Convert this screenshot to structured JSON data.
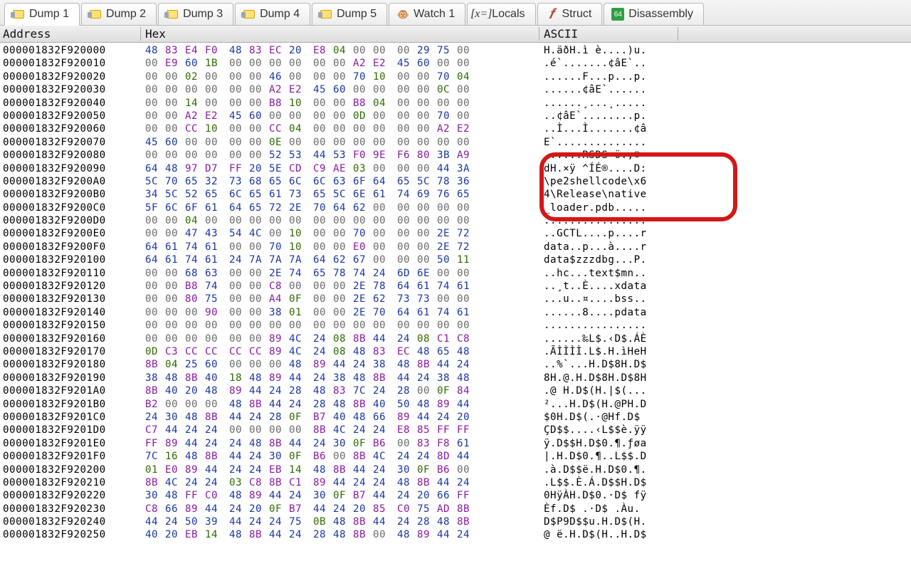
{
  "tabs": [
    {
      "label": "Dump 1",
      "icon": "dump-icon"
    },
    {
      "label": "Dump 2",
      "icon": "dump-icon"
    },
    {
      "label": "Dump 3",
      "icon": "dump-icon"
    },
    {
      "label": "Dump 4",
      "icon": "dump-icon"
    },
    {
      "label": "Dump 5",
      "icon": "dump-icon"
    },
    {
      "label": "Watch 1",
      "icon": "watch-icon"
    },
    {
      "label": "Locals",
      "icon": "locals-icon"
    },
    {
      "label": "Struct",
      "icon": "struct-icon"
    },
    {
      "label": "Disassembly",
      "icon": "disassembly-icon"
    }
  ],
  "active_tab_index": 0,
  "headers": {
    "address": "Address",
    "hex": "Hex",
    "ascii": "ASCII"
  },
  "highlight": {
    "row_start": 9,
    "row_end": 12
  },
  "rows": [
    {
      "addr": "000001832F920000",
      "hex": [
        "48",
        "83",
        "E4",
        "F0",
        "48",
        "83",
        "EC",
        "20",
        "E8",
        "04",
        "00",
        "00",
        "00",
        "29",
        "75",
        "00"
      ],
      "ascii": "H.äðH.ì è....)u."
    },
    {
      "addr": "000001832F920010",
      "hex": [
        "00",
        "E9",
        "60",
        "1B",
        "00",
        "00",
        "00",
        "00",
        "00",
        "00",
        "A2",
        "E2",
        "45",
        "60",
        "00",
        "00"
      ],
      "ascii": ".é`.......¢âE`.."
    },
    {
      "addr": "000001832F920020",
      "hex": [
        "00",
        "00",
        "02",
        "00",
        "00",
        "00",
        "46",
        "00",
        "00",
        "00",
        "70",
        "10",
        "00",
        "00",
        "70",
        "04"
      ],
      "ascii": "......F...p...p."
    },
    {
      "addr": "000001832F920030",
      "hex": [
        "00",
        "00",
        "00",
        "00",
        "00",
        "00",
        "A2",
        "E2",
        "45",
        "60",
        "00",
        "00",
        "00",
        "00",
        "0C",
        "00"
      ],
      "ascii": "......¢âE`......"
    },
    {
      "addr": "000001832F920040",
      "hex": [
        "00",
        "00",
        "14",
        "00",
        "00",
        "00",
        "B8",
        "10",
        "00",
        "00",
        "B8",
        "04",
        "00",
        "00",
        "00",
        "00"
      ],
      "ascii": "......¸...¸....."
    },
    {
      "addr": "000001832F920050",
      "hex": [
        "00",
        "00",
        "A2",
        "E2",
        "45",
        "60",
        "00",
        "00",
        "00",
        "00",
        "0D",
        "00",
        "00",
        "00",
        "70",
        "00"
      ],
      "ascii": "..¢âE`........p."
    },
    {
      "addr": "000001832F920060",
      "hex": [
        "00",
        "00",
        "CC",
        "10",
        "00",
        "00",
        "CC",
        "04",
        "00",
        "00",
        "00",
        "00",
        "00",
        "00",
        "A2",
        "E2"
      ],
      "ascii": "..Ì...Ì.......¢â"
    },
    {
      "addr": "000001832F920070",
      "hex": [
        "45",
        "60",
        "00",
        "00",
        "00",
        "00",
        "0E",
        "00",
        "00",
        "00",
        "00",
        "00",
        "00",
        "00",
        "00",
        "00"
      ],
      "ascii": "E`.............."
    },
    {
      "addr": "000001832F920080",
      "hex": [
        "00",
        "00",
        "00",
        "00",
        "00",
        "00",
        "52",
        "53",
        "44",
        "53",
        "F0",
        "9E",
        "F6",
        "80",
        "3B",
        "A9"
      ],
      "ascii": "......RSDS·ö.;©"
    },
    {
      "addr": "000001832F920090",
      "hex": [
        "64",
        "48",
        "97",
        "D7",
        "FF",
        "20",
        "5E",
        "CD",
        "C9",
        "AE",
        "03",
        "00",
        "00",
        "00",
        "44",
        "3A"
      ],
      "ascii": "dH.×ÿ ^ÍÉ®....D:"
    },
    {
      "addr": "000001832F9200A0",
      "hex": [
        "5C",
        "70",
        "65",
        "32",
        "73",
        "68",
        "65",
        "6C",
        "6C",
        "63",
        "6F",
        "64",
        "65",
        "5C",
        "78",
        "36"
      ],
      "ascii": "\\pe2shellcode\\x6"
    },
    {
      "addr": "000001832F9200B0",
      "hex": [
        "34",
        "5C",
        "52",
        "65",
        "6C",
        "65",
        "61",
        "73",
        "65",
        "5C",
        "6E",
        "61",
        "74",
        "69",
        "76",
        "65"
      ],
      "ascii": "4\\Release\\native"
    },
    {
      "addr": "000001832F9200C0",
      "hex": [
        "5F",
        "6C",
        "6F",
        "61",
        "64",
        "65",
        "72",
        "2E",
        "70",
        "64",
        "62",
        "00",
        "00",
        "00",
        "00",
        "00"
      ],
      "ascii": "_loader.pdb....."
    },
    {
      "addr": "000001832F9200D0",
      "hex": [
        "00",
        "00",
        "04",
        "00",
        "00",
        "00",
        "00",
        "00",
        "00",
        "00",
        "00",
        "00",
        "00",
        "00",
        "00",
        "00"
      ],
      "ascii": "................"
    },
    {
      "addr": "000001832F9200E0",
      "hex": [
        "00",
        "00",
        "47",
        "43",
        "54",
        "4C",
        "00",
        "10",
        "00",
        "00",
        "70",
        "00",
        "00",
        "00",
        "2E",
        "72"
      ],
      "ascii": "..GCTL....p....r"
    },
    {
      "addr": "000001832F9200F0",
      "hex": [
        "64",
        "61",
        "74",
        "61",
        "00",
        "00",
        "70",
        "10",
        "00",
        "00",
        "E0",
        "00",
        "00",
        "00",
        "2E",
        "72"
      ],
      "ascii": "data..p...à....r"
    },
    {
      "addr": "000001832F920100",
      "hex": [
        "64",
        "61",
        "74",
        "61",
        "24",
        "7A",
        "7A",
        "7A",
        "64",
        "62",
        "67",
        "00",
        "00",
        "00",
        "50",
        "11"
      ],
      "ascii": "data$zzzdbg...P."
    },
    {
      "addr": "000001832F920110",
      "hex": [
        "00",
        "00",
        "68",
        "63",
        "00",
        "00",
        "2E",
        "74",
        "65",
        "78",
        "74",
        "24",
        "6D",
        "6E",
        "00",
        "00"
      ],
      "ascii": "..hc...text$mn.."
    },
    {
      "addr": "000001832F920120",
      "hex": [
        "00",
        "00",
        "B8",
        "74",
        "00",
        "00",
        "C8",
        "00",
        "00",
        "00",
        "2E",
        "78",
        "64",
        "61",
        "74",
        "61"
      ],
      "ascii": "..¸t..È....xdata"
    },
    {
      "addr": "000001832F920130",
      "hex": [
        "00",
        "00",
        "80",
        "75",
        "00",
        "00",
        "A4",
        "0F",
        "00",
        "00",
        "2E",
        "62",
        "73",
        "73",
        "00",
        "00"
      ],
      "ascii": "...u..¤....bss.."
    },
    {
      "addr": "000001832F920140",
      "hex": [
        "00",
        "00",
        "00",
        "90",
        "00",
        "00",
        "38",
        "01",
        "00",
        "00",
        "2E",
        "70",
        "64",
        "61",
        "74",
        "61"
      ],
      "ascii": "......8....pdata"
    },
    {
      "addr": "000001832F920150",
      "hex": [
        "00",
        "00",
        "00",
        "00",
        "00",
        "00",
        "00",
        "00",
        "00",
        "00",
        "00",
        "00",
        "00",
        "00",
        "00",
        "00"
      ],
      "ascii": "................"
    },
    {
      "addr": "000001832F920160",
      "hex": [
        "00",
        "00",
        "00",
        "00",
        "00",
        "00",
        "89",
        "4C",
        "24",
        "08",
        "8B",
        "44",
        "24",
        "08",
        "C1",
        "C8"
      ],
      "ascii": "......‰L$.‹D$.ÁÈ"
    },
    {
      "addr": "000001832F920170",
      "hex": [
        "0D",
        "C3",
        "CC",
        "CC",
        "CC",
        "CC",
        "89",
        "4C",
        "24",
        "08",
        "48",
        "83",
        "EC",
        "48",
        "65",
        "48"
      ],
      "ascii": ".ÃÌÌÌÌ.L$.H.ìHeH"
    },
    {
      "addr": "000001832F920180",
      "hex": [
        "8B",
        "04",
        "25",
        "60",
        "00",
        "00",
        "00",
        "48",
        "89",
        "44",
        "24",
        "38",
        "48",
        "8B",
        "44",
        "24"
      ],
      "ascii": "..%`...H.D$8H.D$"
    },
    {
      "addr": "000001832F920190",
      "hex": [
        "38",
        "48",
        "8B",
        "40",
        "18",
        "48",
        "89",
        "44",
        "24",
        "38",
        "48",
        "8B",
        "44",
        "24",
        "38",
        "48"
      ],
      "ascii": "8H.@.H.D$8H.D$8H"
    },
    {
      "addr": "000001832F9201A0",
      "hex": [
        "8B",
        "40",
        "20",
        "48",
        "89",
        "44",
        "24",
        "28",
        "48",
        "83",
        "7C",
        "24",
        "28",
        "00",
        "0F",
        "84"
      ],
      "ascii": ".@ H.D$(H.|$(..."
    },
    {
      "addr": "000001832F9201B0",
      "hex": [
        "B2",
        "00",
        "00",
        "00",
        "48",
        "8B",
        "44",
        "24",
        "28",
        "48",
        "8B",
        "40",
        "50",
        "48",
        "89",
        "44"
      ],
      "ascii": "²...H.D$(H.@PH.D"
    },
    {
      "addr": "000001832F9201C0",
      "hex": [
        "24",
        "30",
        "48",
        "8B",
        "44",
        "24",
        "28",
        "0F",
        "B7",
        "40",
        "48",
        "66",
        "89",
        "44",
        "24",
        "20"
      ],
      "ascii": "$0H.D$(.·@Hf.D$ "
    },
    {
      "addr": "000001832F9201D0",
      "hex": [
        "C7",
        "44",
        "24",
        "24",
        "00",
        "00",
        "00",
        "00",
        "8B",
        "4C",
        "24",
        "24",
        "E8",
        "85",
        "FF",
        "FF"
      ],
      "ascii": "ÇD$$....‹L$$è.ÿÿ"
    },
    {
      "addr": "000001832F9201E0",
      "hex": [
        "FF",
        "89",
        "44",
        "24",
        "24",
        "48",
        "8B",
        "44",
        "24",
        "30",
        "0F",
        "B6",
        "00",
        "83",
        "F8",
        "61"
      ],
      "ascii": "ÿ.D$$H.D$0.¶.ƒøa"
    },
    {
      "addr": "000001832F9201F0",
      "hex": [
        "7C",
        "16",
        "48",
        "8B",
        "44",
        "24",
        "30",
        "0F",
        "B6",
        "00",
        "8B",
        "4C",
        "24",
        "24",
        "8D",
        "44"
      ],
      "ascii": "|.H.D$0.¶..L$$.D"
    },
    {
      "addr": "000001832F920200",
      "hex": [
        "01",
        "E0",
        "89",
        "44",
        "24",
        "24",
        "EB",
        "14",
        "48",
        "8B",
        "44",
        "24",
        "30",
        "0F",
        "B6",
        "00"
      ],
      "ascii": ".à.D$$ë.H.D$0.¶."
    },
    {
      "addr": "000001832F920210",
      "hex": [
        "8B",
        "4C",
        "24",
        "24",
        "03",
        "C8",
        "8B",
        "C1",
        "89",
        "44",
        "24",
        "24",
        "48",
        "8B",
        "44",
        "24"
      ],
      "ascii": ".L$$.È.Á.D$$H.D$"
    },
    {
      "addr": "000001832F920220",
      "hex": [
        "30",
        "48",
        "FF",
        "C0",
        "48",
        "89",
        "44",
        "24",
        "30",
        "0F",
        "B7",
        "44",
        "24",
        "20",
        "66",
        "FF"
      ],
      "ascii": "0HÿÀH.D$0.·D$ fÿ"
    },
    {
      "addr": "000001832F920230",
      "hex": [
        "C8",
        "66",
        "89",
        "44",
        "24",
        "20",
        "0F",
        "B7",
        "44",
        "24",
        "20",
        "85",
        "C0",
        "75",
        "AD",
        "8B"
      ],
      "ascii": "Èf.D$ .·D$ .Àu­."
    },
    {
      "addr": "000001832F920240",
      "hex": [
        "44",
        "24",
        "50",
        "39",
        "44",
        "24",
        "24",
        "75",
        "0B",
        "48",
        "8B",
        "44",
        "24",
        "28",
        "48",
        "8B"
      ],
      "ascii": "D$P9D$$u.H.D$(H."
    },
    {
      "addr": "000001832F920250",
      "hex": [
        "40",
        "20",
        "EB",
        "14",
        "48",
        "8B",
        "44",
        "24",
        "28",
        "48",
        "8B",
        "00",
        "48",
        "89",
        "44",
        "24"
      ],
      "ascii": "@ ë.H.D$(H..H.D$"
    }
  ]
}
